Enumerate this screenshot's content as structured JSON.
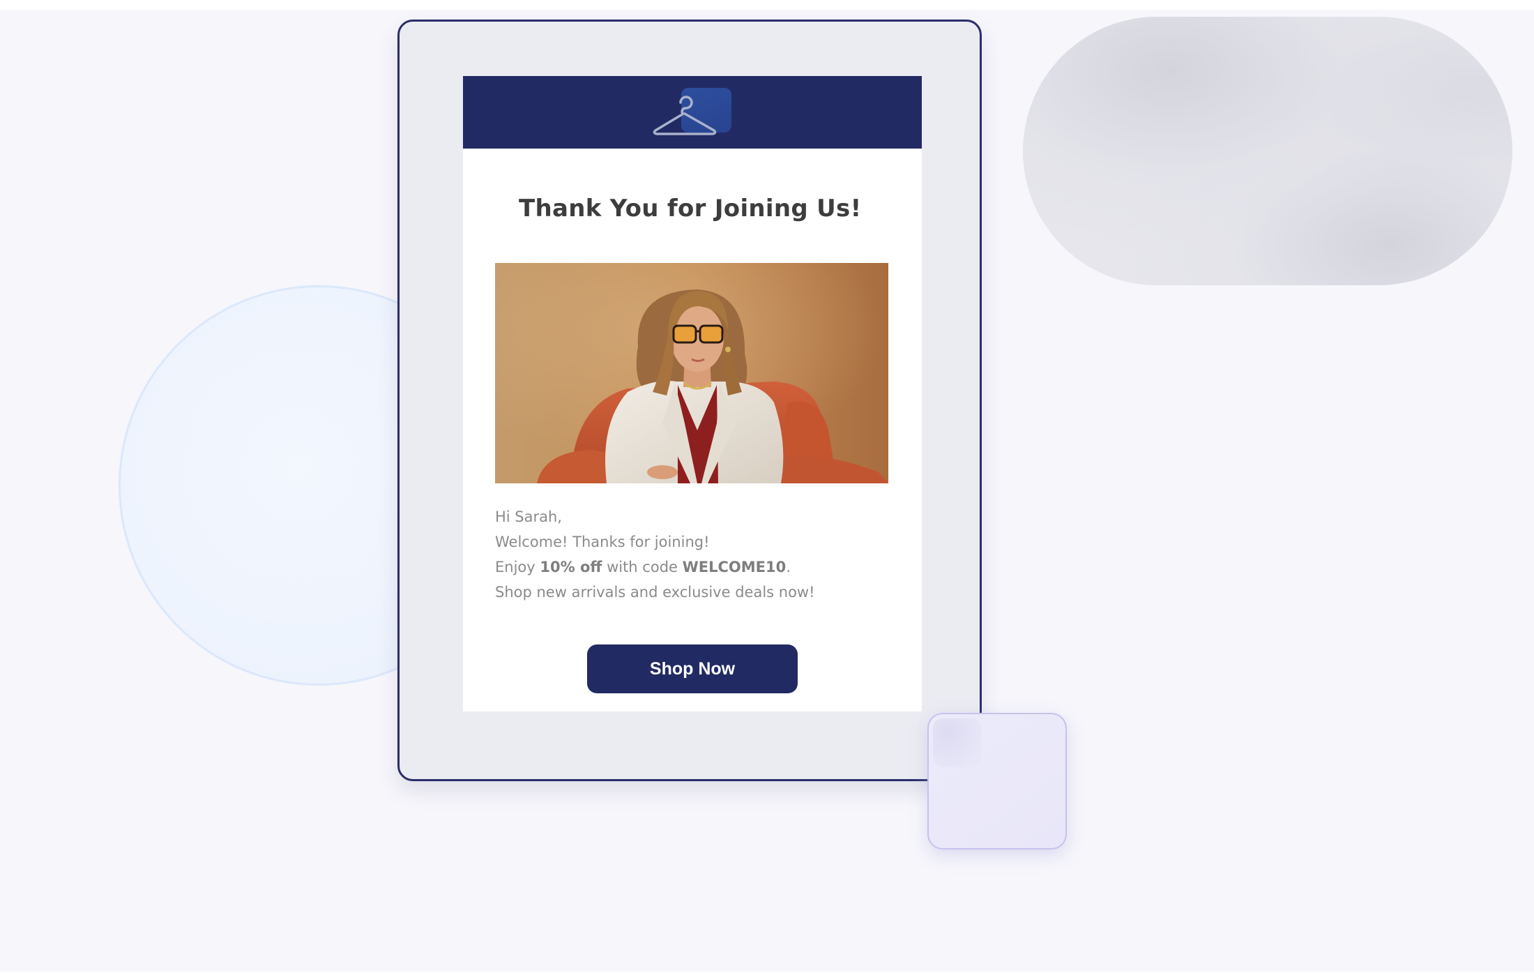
{
  "email": {
    "title": "Thank You for Joining Us!",
    "greeting": "Hi Sarah,",
    "welcome_line": "Welcome! Thanks for joining!",
    "offer_prefix": "Enjoy ",
    "offer_discount": "10% off",
    "offer_middle": " with code ",
    "offer_code": "WELCOME10",
    "offer_suffix": ".",
    "shop_line": "Shop new arrivals and exclusive deals now!",
    "cta_label": "Shop Now"
  },
  "header": {
    "logo_icon": "clothes-hanger-icon"
  },
  "hero": {
    "image_icon": "woman-in-sunglasses-photo"
  },
  "colors": {
    "brand_navy": "#222a63",
    "frame_border": "#2b2d6a",
    "body_text": "#8a8a8a",
    "title_text": "#3d3d3d",
    "page_background": "#f6f6fb"
  }
}
